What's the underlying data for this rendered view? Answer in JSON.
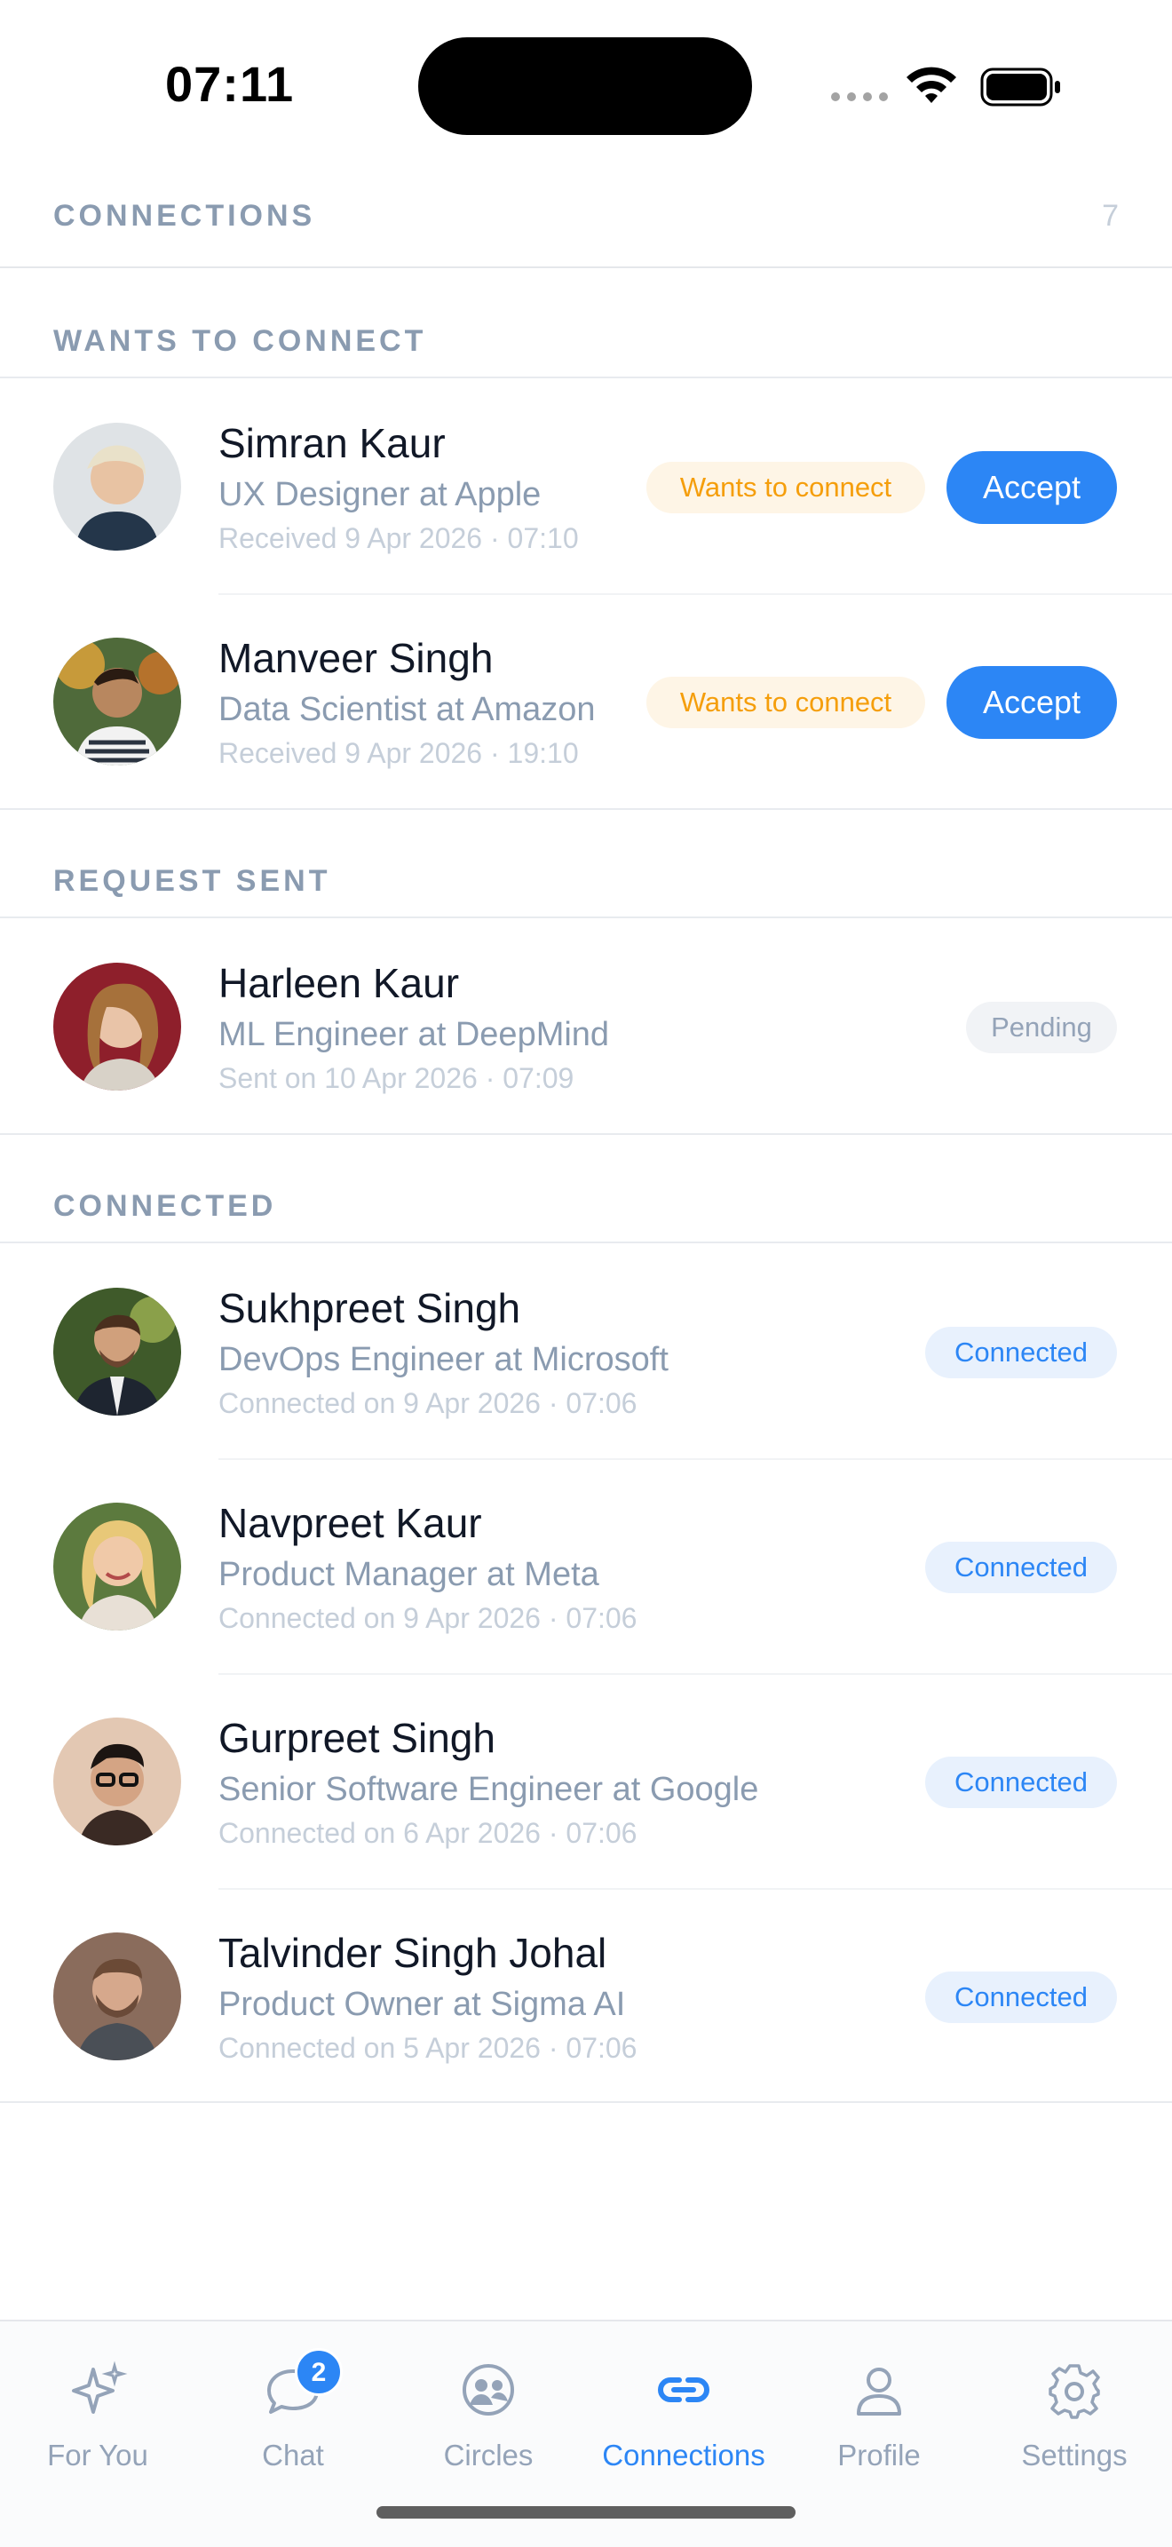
{
  "status_bar": {
    "time": "07:11"
  },
  "header": {
    "title": "CONNECTIONS",
    "count": "7"
  },
  "sections": {
    "wants": "WANTS TO CONNECT",
    "sent": "REQUEST SENT",
    "connected": "CONNECTED"
  },
  "wants": [
    {
      "name": "Simran Kaur",
      "role": "UX Designer at Apple",
      "meta": "Received 9 Apr 2026 · 07:10",
      "tag": "Wants to connect",
      "action": "Accept"
    },
    {
      "name": "Manveer Singh",
      "role": "Data Scientist at Amazon",
      "meta": "Received 9 Apr 2026 · 19:10",
      "tag": "Wants to connect",
      "action": "Accept"
    }
  ],
  "sent": [
    {
      "name": "Harleen Kaur",
      "role": "ML Engineer at DeepMind",
      "meta": "Sent on 10 Apr 2026 · 07:09",
      "tag": "Pending"
    }
  ],
  "connected": [
    {
      "name": "Sukhpreet Singh",
      "role": "DevOps Engineer at Microsoft",
      "meta": "Connected on 9 Apr 2026 · 07:06",
      "tag": "Connected"
    },
    {
      "name": "Navpreet Kaur",
      "role": "Product Manager at Meta",
      "meta": "Connected on 9 Apr 2026 · 07:06",
      "tag": "Connected"
    },
    {
      "name": "Gurpreet Singh",
      "role": "Senior Software Engineer at Google",
      "meta": "Connected on 6 Apr 2026 · 07:06",
      "tag": "Connected"
    },
    {
      "name": "Talvinder Singh Johal",
      "role": "Product Owner at Sigma AI",
      "meta": "Connected on 5 Apr 2026 · 07:06",
      "tag": "Connected"
    }
  ],
  "tabs": [
    {
      "label": "For You",
      "icon": "sparkles-icon"
    },
    {
      "label": "Chat",
      "icon": "chat-bubble-icon",
      "badge": "2"
    },
    {
      "label": "Circles",
      "icon": "circles-icon"
    },
    {
      "label": "Connections",
      "icon": "link-icon",
      "active": true
    },
    {
      "label": "Profile",
      "icon": "person-icon"
    },
    {
      "label": "Settings",
      "icon": "gear-icon"
    }
  ],
  "colors": {
    "accent": "#2c86f5",
    "warning": "#f59e0b",
    "muted": "#8a9bb0"
  }
}
